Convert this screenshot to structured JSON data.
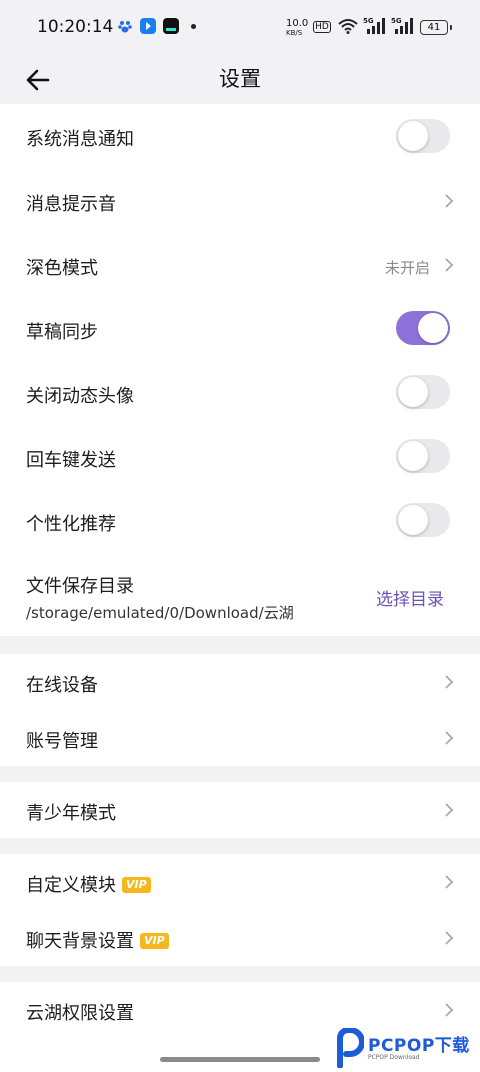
{
  "status_bar": {
    "time": "10:20:14",
    "net_speed": "10.0",
    "net_unit": "KB/S",
    "hd": "HD",
    "sim1": "5G",
    "sim2": "5G",
    "battery": "41"
  },
  "header": {
    "title": "设置",
    "back_icon": "arrow-left-icon"
  },
  "section1": {
    "system_notify": {
      "label": "系统消息通知",
      "on": false
    },
    "notify_sound": {
      "label": "消息提示音"
    },
    "dark_mode": {
      "label": "深色模式",
      "value": "未开启"
    },
    "draft_sync": {
      "label": "草稿同步",
      "on": true
    },
    "disable_avatar": {
      "label": "关闭动态头像",
      "on": false
    },
    "enter_send": {
      "label": "回车键发送",
      "on": false
    },
    "personal_rec": {
      "label": "个性化推荐",
      "on": false
    },
    "file_dir": {
      "label": "文件保存目录",
      "path": "/storage/emulated/0/Download/云湖",
      "action": "选择目录"
    }
  },
  "section2": {
    "online_devices": "在线设备",
    "account_manage": "账号管理"
  },
  "section3": {
    "teen_mode": "青少年模式"
  },
  "section4": {
    "custom_module": "自定义模块",
    "chat_background": "聊天背景设置",
    "vip_badge": "VIP"
  },
  "section5": {
    "permissions": "云湖权限设置"
  },
  "watermark": {
    "brand": "PCPOP下载",
    "sub": "PCPOP Download"
  },
  "colors": {
    "accent": "#8f72d9",
    "link": "#6a52b8",
    "vip": "#f5b81c",
    "background": "#f2f2f4"
  }
}
